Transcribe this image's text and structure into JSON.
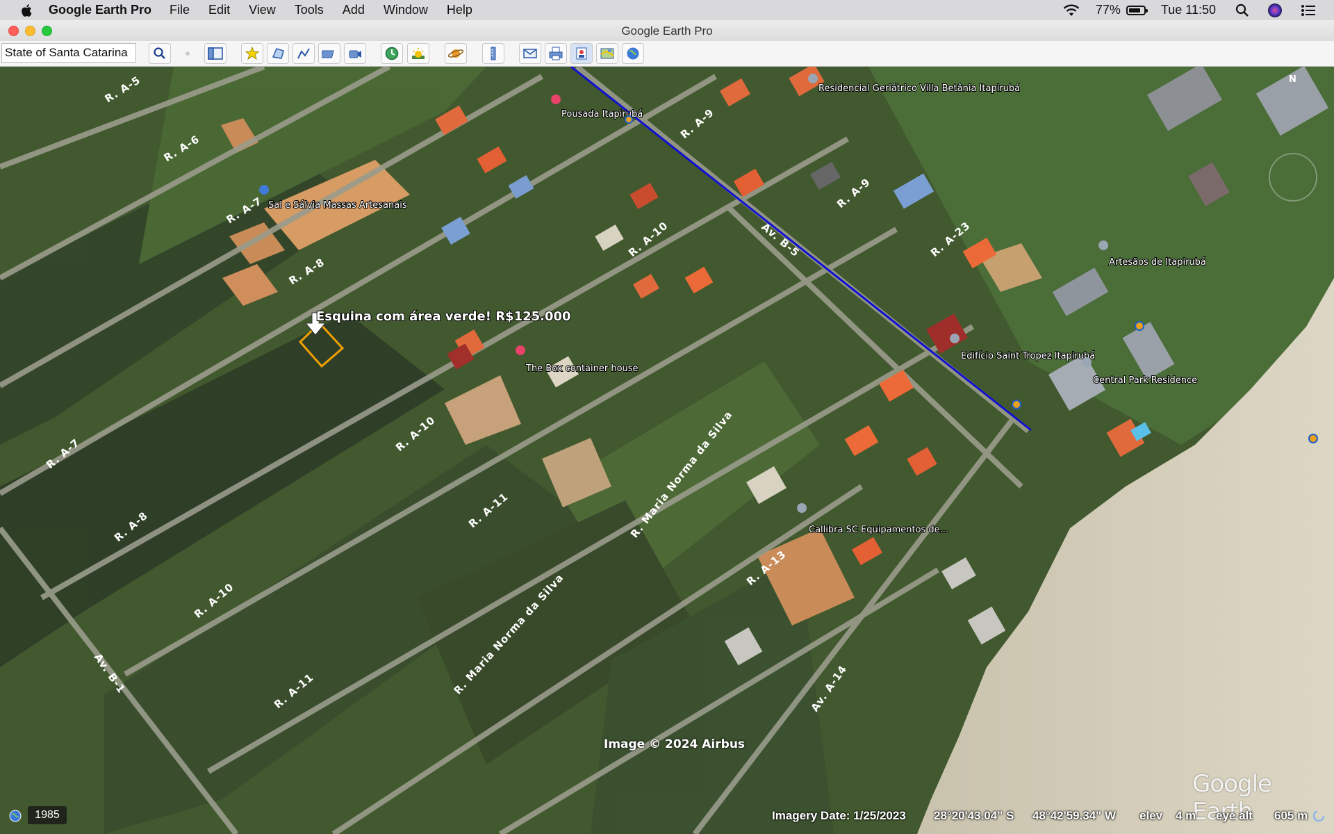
{
  "menubar": {
    "app_name": "Google Earth Pro",
    "menus": [
      "File",
      "Edit",
      "View",
      "Tools",
      "Add",
      "Window",
      "Help"
    ],
    "battery": "77%",
    "clock": "Tue 11:50"
  },
  "window": {
    "title": "Google Earth Pro"
  },
  "toolbar": {
    "search_value": "State of Santa Catarina",
    "buttons": [
      "search-icon",
      "dot-icon",
      "sidebar-toggle-icon",
      "placemark-icon",
      "polygon-icon",
      "path-icon",
      "image-overlay-icon",
      "record-tour-icon",
      "historical-imagery-icon",
      "sunlight-icon",
      "planets-icon",
      "ruler-icon",
      "email-icon",
      "print-icon",
      "save-image-icon",
      "view-in-maps-icon",
      "earth-view-icon"
    ]
  },
  "map": {
    "annotation_text": "Esquina com área verde! R$125.000",
    "places": [
      {
        "name": "Residencial Geriátrico Villa Betânia Itapirubá",
        "icon": "location-pin-icon"
      },
      {
        "name": "Pousada Itapirubá",
        "icon": "hotel-pin-icon"
      },
      {
        "name": "Sal e Sálvia Massas Artesanais",
        "icon": "shop-pin-icon"
      },
      {
        "name": "Artesãos de Itapirubá",
        "icon": "location-pin-icon"
      },
      {
        "name": "The Box container house",
        "icon": "hotel-pin-icon"
      },
      {
        "name": "Edifício Saint Tropez Itapirubá",
        "icon": "location-pin-icon"
      },
      {
        "name": "Central Park Residence",
        "icon": "location-pin-icon"
      },
      {
        "name": "Callibra SC Equipamentos de...",
        "icon": "location-pin-icon"
      }
    ],
    "roads": [
      "R. A-5",
      "R. A-6",
      "R. A-7",
      "R. A-8",
      "R. A-9",
      "R. A-10",
      "R. A-11",
      "R. A-13",
      "R. A-7",
      "R. A-8",
      "R. A-9",
      "R. A-10",
      "R. A-10",
      "R. A-11",
      "R. A-23",
      "Av. B-5",
      "Av. B-1",
      "Av. A-14",
      "R. Maria Norma da Silva",
      "R. Maria Norma da Silva",
      "R. A-11"
    ],
    "copyright": "Image © 2024 Airbus",
    "logo": "Google Earth",
    "compass": "N"
  },
  "status": {
    "year": "1985",
    "imagery_date": "Imagery Date: 1/25/2023",
    "lat": "28°20'43.04\" S",
    "lon": "48°42'59.34\" W",
    "elev_label": "elev",
    "elev_value": "4 m",
    "eye_alt_label": "eye alt",
    "eye_alt_value": "605 m"
  },
  "colors": {
    "path_line": "#1010d0",
    "polygon_outline": "#f0a000",
    "hotel_pin": "#e8426a",
    "location_pin": "#8a9aaa"
  }
}
